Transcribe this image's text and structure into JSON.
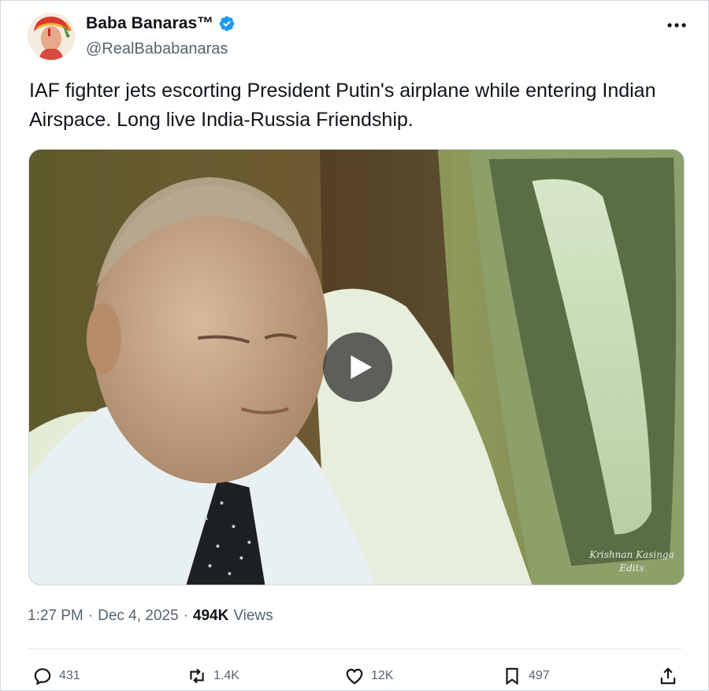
{
  "author": {
    "display_name": "Baba Banaras™",
    "handle": "@RealBababanaras",
    "verified": true,
    "avatar_icon": "profile-avatar"
  },
  "more_icon": "more-icon",
  "tweet": {
    "text_line1": "IAF fighter jets escorting President Putin's airplane while entering Indian",
    "text_line2": "Airspace. Long live India-Russia Friendship."
  },
  "media": {
    "type": "video",
    "play_icon": "play-icon",
    "watermark_line1": "Krishnan Kasinga",
    "watermark_line2": "Edits"
  },
  "meta": {
    "time": "1:27 PM",
    "sep1": "·",
    "date": "Dec 4, 2025",
    "sep2": "·",
    "views_count": "494K",
    "views_label": "Views"
  },
  "actions": {
    "reply": {
      "icon": "reply-icon",
      "count": "431"
    },
    "repost": {
      "icon": "repost-icon",
      "count": "1.4K"
    },
    "like": {
      "icon": "like-icon",
      "count": "12K"
    },
    "bookmark": {
      "icon": "bookmark-icon",
      "count": "497"
    },
    "share": {
      "icon": "share-icon"
    }
  },
  "colors": {
    "text_primary": "#0f1419",
    "text_secondary": "#536471",
    "verified_blue": "#1d9bf0",
    "border": "#cfd9de"
  }
}
